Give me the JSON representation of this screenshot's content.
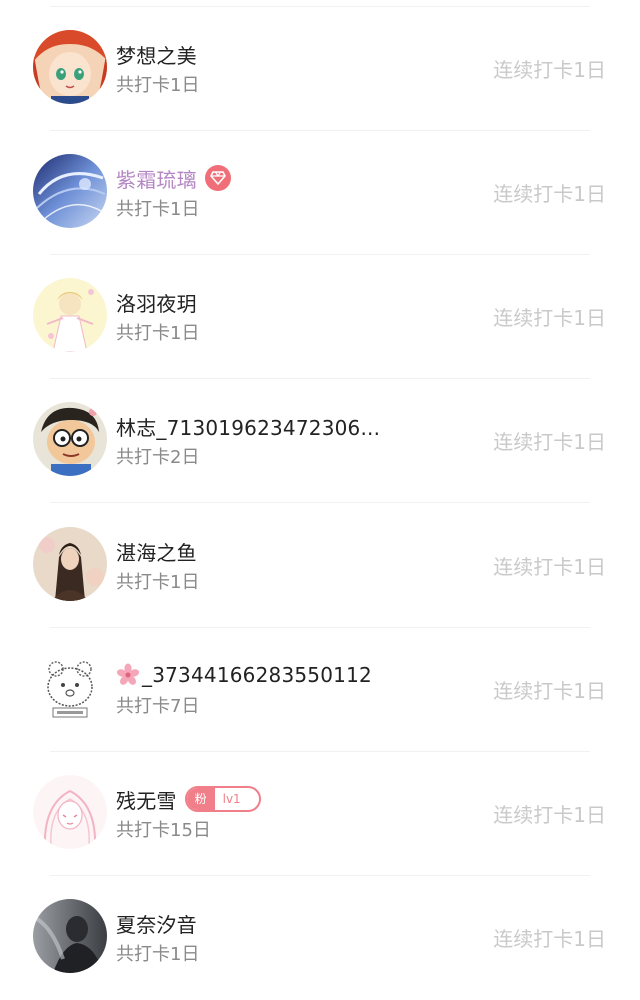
{
  "checkin_list": [
    {
      "name": "梦想之美",
      "total": "共打卡1日",
      "streak": "连续打卡1日",
      "vip": false,
      "badge": null,
      "avatar_icon": "anime-girl-red-hair-avatar"
    },
    {
      "name": "紫霜琉璃",
      "total": "共打卡1日",
      "streak": "连续打卡1日",
      "vip": true,
      "badge": "diamond",
      "avatar_icon": "blue-fantasy-art-avatar"
    },
    {
      "name": "洛羽夜玥",
      "total": "共打卡1日",
      "streak": "连续打卡1日",
      "vip": false,
      "badge": null,
      "avatar_icon": "pastel-anime-girl-avatar"
    },
    {
      "name": "林志_713019623472306...",
      "total": "共打卡2日",
      "streak": "连续打卡1日",
      "vip": false,
      "badge": null,
      "avatar_icon": "cartoon-boy-glasses-avatar"
    },
    {
      "name": "湛海之鱼",
      "total": "共打卡1日",
      "streak": "连续打卡1日",
      "vip": false,
      "badge": null,
      "avatar_icon": "photo-woman-flowers-avatar"
    },
    {
      "name": "_37344166283550112",
      "total": "共打卡7日",
      "streak": "连续打卡1日",
      "vip": false,
      "badge": "flower",
      "avatar_icon": "sketch-bear-avatar"
    },
    {
      "name": "残无雪",
      "total": "共打卡15日",
      "streak": "连续打卡1日",
      "vip": false,
      "badge": "fan",
      "fan_label": "粉",
      "level_label": "lv1",
      "avatar_icon": "pink-sketch-girl-avatar"
    },
    {
      "name": "夏奈汐音",
      "total": "共打卡1日",
      "streak": "连续打卡1日",
      "vip": false,
      "badge": null,
      "avatar_icon": "dark-photo-figure-avatar"
    }
  ],
  "colors": {
    "vip_name": "#b487c4",
    "badge_pink": "#f06e78",
    "streak_gray": "#c9c9c9",
    "sub_gray": "#8a8a8a"
  }
}
